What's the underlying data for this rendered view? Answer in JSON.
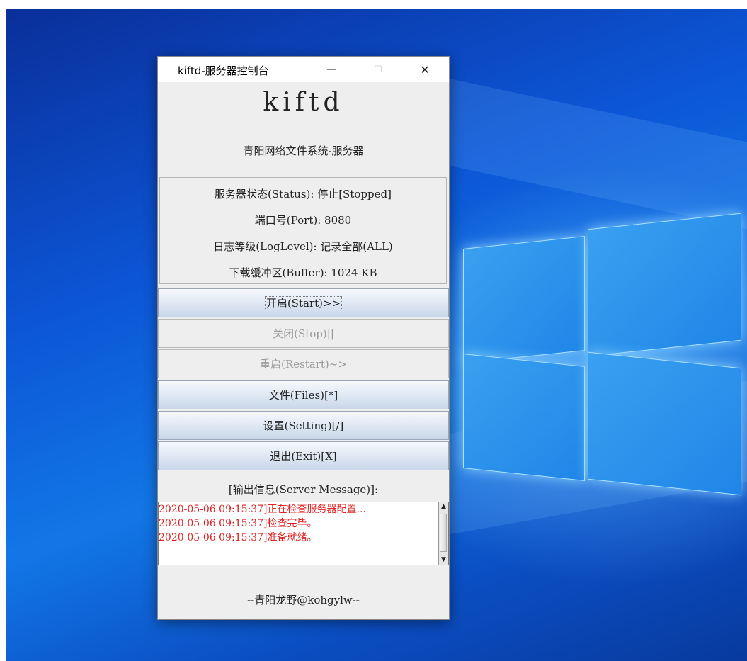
{
  "window": {
    "title": "kiftd-服务器控制台",
    "minimize_glyph": "—",
    "maximize_glyph": "☐",
    "close_glyph": "✕"
  },
  "header": {
    "app_name": "kiftd",
    "subtitle": "青阳网络文件系统-服务器"
  },
  "status": {
    "server_status": "服务器状态(Status): 停止[Stopped]",
    "port": "端口号(Port): 8080",
    "log_level": "日志等级(LogLevel): 记录全部(ALL)",
    "buffer": "下载缓冲区(Buffer): 1024 KB"
  },
  "buttons": {
    "start": "开启(Start)>>",
    "stop": "关闭(Stop)||",
    "restart": "重启(Restart)~>",
    "files": "文件(Files)[*]",
    "setting": "设置(Setting)[/]",
    "exit": "退出(Exit)[X]"
  },
  "messages": {
    "title": "[输出信息(Server Message)]:",
    "lines": [
      "2020-05-06 09:15:37]正在检查服务器配置...",
      "2020-05-06 09:15:37]检查完毕。",
      "2020-05-06 09:15:37]准备就绪。"
    ]
  },
  "footer": {
    "author": "--青阳龙野@kohgylw--"
  },
  "colors": {
    "log_text": "#e02020",
    "desktop": "#0c56d6"
  }
}
